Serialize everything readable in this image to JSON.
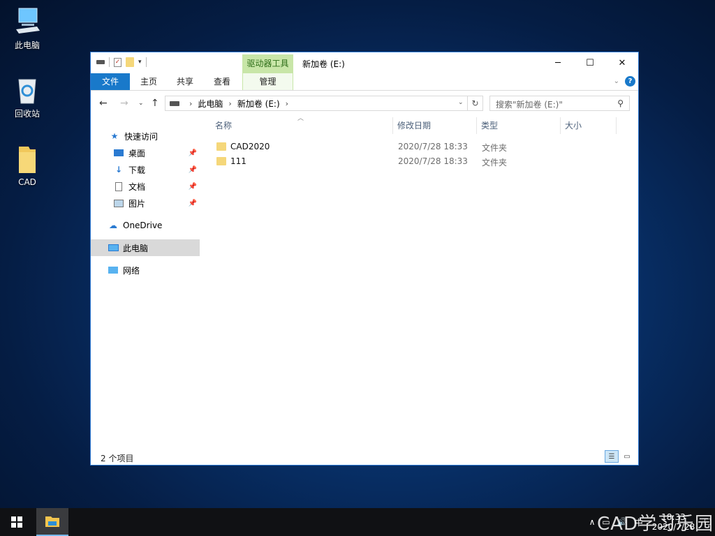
{
  "desktop": {
    "icons": [
      {
        "label": "此电脑",
        "icon": "computer-icon"
      },
      {
        "label": "回收站",
        "icon": "recycle-bin-icon"
      },
      {
        "label": "CAD",
        "icon": "folder-icon"
      }
    ]
  },
  "window": {
    "title": "新加卷 (E:)",
    "context_tab_group": "驱动器工具",
    "ribbon_tabs": [
      "文件",
      "主页",
      "共享",
      "查看",
      "管理"
    ],
    "controls": {
      "minimize": "─",
      "maximize": "☐",
      "close": "✕"
    },
    "address": {
      "crumbs": [
        "此电脑",
        "新加卷 (E:)"
      ]
    },
    "search": {
      "placeholder": "搜索\"新加卷 (E:)\""
    },
    "nav": {
      "quick_access": "快速访问",
      "quick_items": [
        "桌面",
        "下载",
        "文档",
        "图片"
      ],
      "onedrive": "OneDrive",
      "this_pc": "此电脑",
      "network": "网络"
    },
    "columns": [
      "名称",
      "修改日期",
      "类型",
      "大小"
    ],
    "files": [
      {
        "name": "CAD2020",
        "date": "2020/7/28 18:33",
        "type": "文件夹"
      },
      {
        "name": "111",
        "date": "2020/7/28 18:33",
        "type": "文件夹"
      }
    ],
    "status": "2 个项目"
  },
  "taskbar": {
    "clock_time": "18:33",
    "clock_date": "2020/7/28",
    "ime": "中",
    "watermark": "CAD学习乐园"
  },
  "colors": {
    "accent": "#1979ca",
    "context_tab": "#c8e6a8",
    "folder": "#f5d77a"
  }
}
